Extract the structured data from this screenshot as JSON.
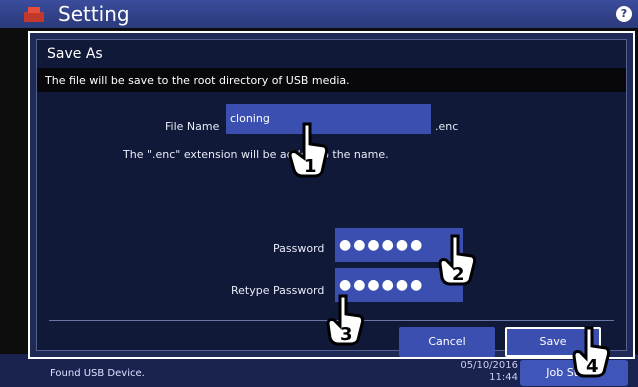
{
  "background": {
    "title": "Setting",
    "help_icon": "?",
    "status_text": "Found USB Device.",
    "date_text": "05/10/2016",
    "time_text": "11:44",
    "job_button": "Job Status"
  },
  "dialog": {
    "title": "Save As",
    "info": "The file will be save to the root directory of USB media.",
    "file_name_label": "File Name",
    "file_name_value": "cloning",
    "extension": ".enc",
    "note": "The \".enc\" extension will be added to the name.",
    "password_label": "Password",
    "password_value": "●●●●●●",
    "retype_label": "Retype Password",
    "retype_value": "●●●●●●",
    "cancel_label": "Cancel",
    "save_label": "Save"
  },
  "steps": [
    "1",
    "2",
    "3",
    "4"
  ],
  "icons": [
    "printer-logo-icon",
    "help-icon",
    "hand-pointer-icon"
  ],
  "colors": {
    "accent": "#3b4fb0",
    "dialog_bg": "#101938"
  }
}
